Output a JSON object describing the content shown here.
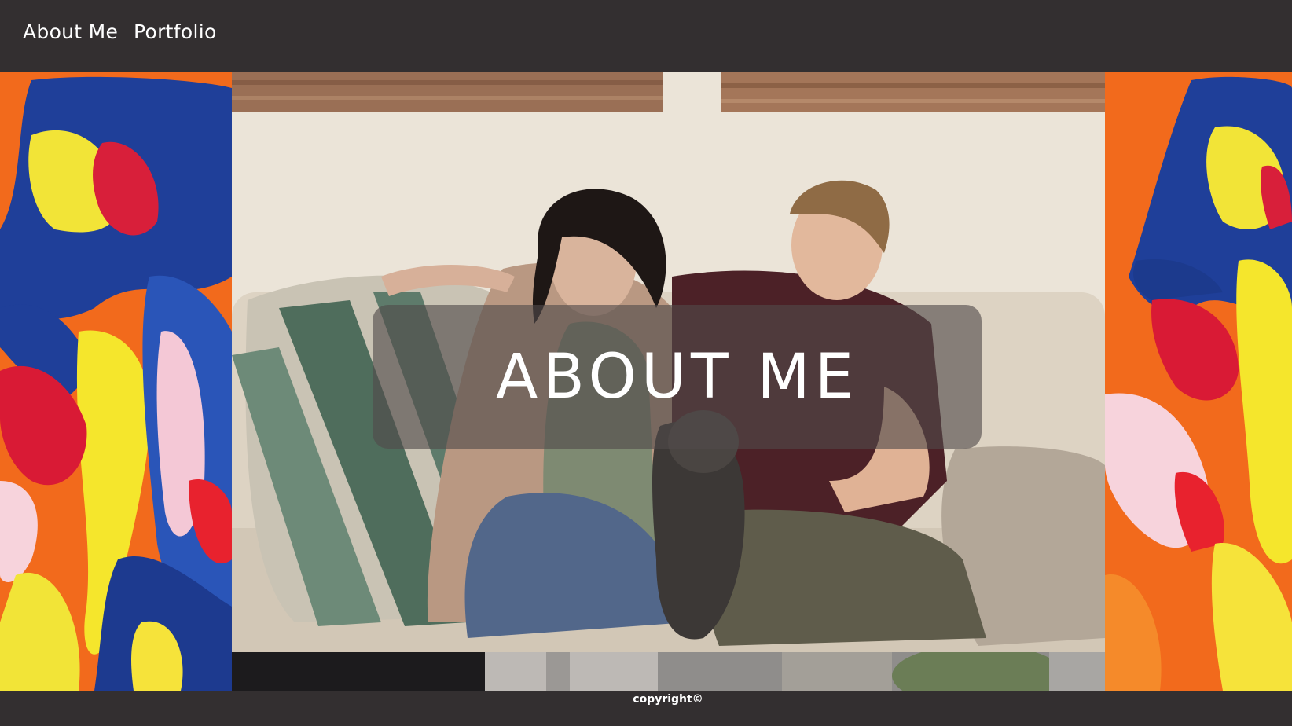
{
  "nav": {
    "items": [
      {
        "label": "About Me"
      },
      {
        "label": "Portfolio"
      }
    ]
  },
  "hero": {
    "title": "ABOUT ME"
  },
  "footer": {
    "copyright": "copyright©"
  },
  "colors": {
    "background": "#332f30",
    "title_box": "rgba(80,74,74,0.62)",
    "text": "#ffffff"
  }
}
